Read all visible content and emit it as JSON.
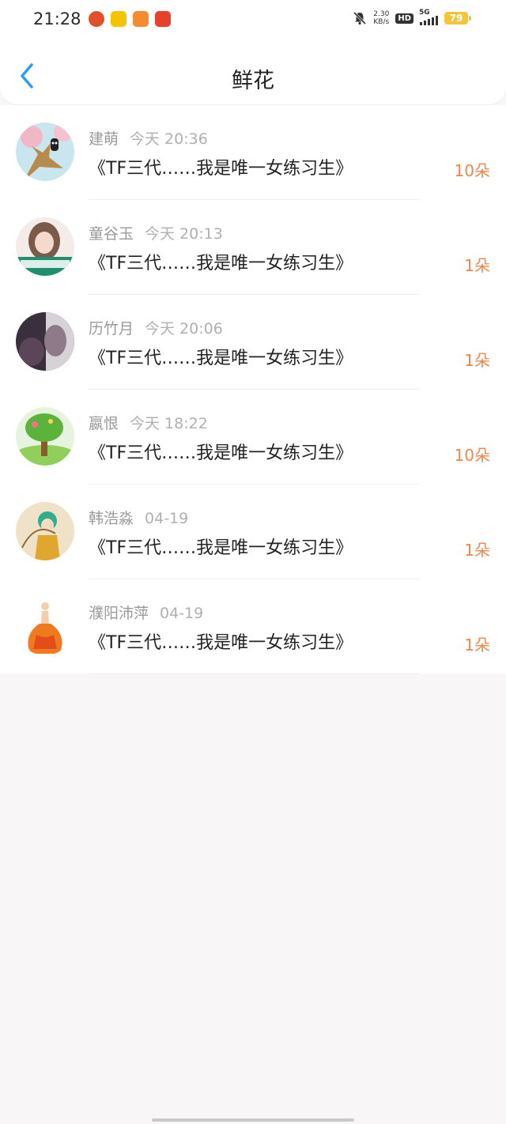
{
  "status_bar": {
    "time": "21:28",
    "net_speed_value": "2.30",
    "net_speed_unit": "KB/s",
    "hd_label": "HD",
    "network_label": "5G",
    "battery_level": "79",
    "app_icons": [
      "reminder-app-icon",
      "assistant-app-icon",
      "video-app-icon",
      "shopping-app-icon"
    ]
  },
  "header": {
    "title": "鲜花",
    "back_icon": "chevron-left-icon"
  },
  "colors": {
    "accent": "#2f9ee8",
    "count": "#f0864a",
    "name": "#9a9a9a"
  },
  "items": [
    {
      "name": "建萌",
      "time": "今天 20:36",
      "title": "《TF三代……我是唯一女练习生》",
      "count": "10朵"
    },
    {
      "name": "童谷玉",
      "time": "今天 20:13",
      "title": "《TF三代……我是唯一女练习生》",
      "count": "1朵"
    },
    {
      "name": "历竹月",
      "time": "今天 20:06",
      "title": "《TF三代……我是唯一女练习生》",
      "count": "1朵"
    },
    {
      "name": "嬴恨",
      "time": "今天 18:22",
      "title": "《TF三代……我是唯一女练习生》",
      "count": "10朵"
    },
    {
      "name": "韩浩淼",
      "time": "04-19",
      "title": "《TF三代……我是唯一女练习生》",
      "count": "1朵"
    },
    {
      "name": "濮阳沛萍",
      "time": "04-19",
      "title": "《TF三代……我是唯一女练习生》",
      "count": "1朵"
    }
  ]
}
